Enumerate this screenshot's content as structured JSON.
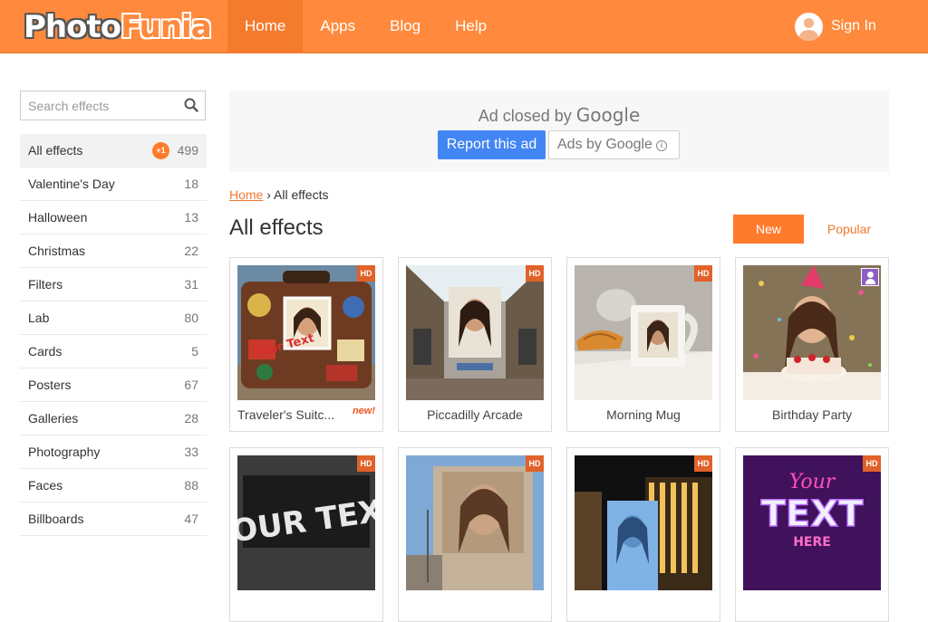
{
  "header": {
    "logo_part1": "Photo",
    "logo_part2": "Funia",
    "nav": [
      {
        "label": "Home"
      },
      {
        "label": "Apps"
      },
      {
        "label": "Blog"
      },
      {
        "label": "Help"
      }
    ],
    "sign_in_label": "Sign In"
  },
  "sidebar": {
    "search_placeholder": "Search effects",
    "categories": [
      {
        "label": "All effects",
        "count": "499",
        "badge": "+1"
      },
      {
        "label": "Valentine's Day",
        "count": "18"
      },
      {
        "label": "Halloween",
        "count": "13"
      },
      {
        "label": "Christmas",
        "count": "22"
      },
      {
        "label": "Filters",
        "count": "31"
      },
      {
        "label": "Lab",
        "count": "80"
      },
      {
        "label": "Cards",
        "count": "5"
      },
      {
        "label": "Posters",
        "count": "67"
      },
      {
        "label": "Galleries",
        "count": "28"
      },
      {
        "label": "Photography",
        "count": "33"
      },
      {
        "label": "Faces",
        "count": "88"
      },
      {
        "label": "Billboards",
        "count": "47"
      }
    ]
  },
  "ad": {
    "closed_prefix": "Ad closed by",
    "closed_brand": "Google",
    "report_label": "Report this ad",
    "ads_by_label": "Ads by Google",
    "info_glyph": "i"
  },
  "breadcrumb": {
    "home": "Home",
    "separator": "›",
    "current": "All effects"
  },
  "main": {
    "title": "All effects",
    "sort_new": "New",
    "sort_popular": "Popular",
    "hd_label": "HD",
    "effects": [
      {
        "title": "Traveler's Suitc...",
        "tag": "new!"
      },
      {
        "title": "Piccadilly Arcade"
      },
      {
        "title": "Morning Mug"
      },
      {
        "title": "Birthday Party"
      },
      {
        "title": "",
        "thumb_text": "\"YOUR TEXT\""
      },
      {
        "title": ""
      },
      {
        "title": ""
      },
      {
        "title": "",
        "thumb_text_1": "Your",
        "thumb_text_2": "TEXT",
        "thumb_text_3": "HERE"
      }
    ]
  },
  "colors": {
    "brand_orange": "#ff8a3d",
    "accent_orange": "#ff7b2c",
    "google_blue": "#4285f4",
    "hd_badge": "#e0622a",
    "user_badge": "#8d5fc2"
  }
}
